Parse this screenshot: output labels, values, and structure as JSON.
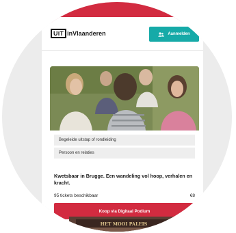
{
  "header": {
    "logo_box": "UiT",
    "logo_text": "inVlaanderen",
    "login_label": "Aanmelden"
  },
  "event": {
    "tags": [
      "Begeleide uitstap of rondleiding",
      "Persoon en relaties"
    ],
    "title": "Kwetsbaar in Brugge. Een wandeling vol hoop, verhalen en kracht.",
    "tickets": "95 tickets beschikbaar",
    "price": "€8",
    "buy_label": "Koop via Digitaal Podium"
  },
  "next_event": {
    "sign_text": "HET MOOI PALEIS"
  },
  "colors": {
    "brand_red": "#d22b40",
    "teal": "#16aaa8"
  },
  "icons": {
    "login": "users-icon"
  }
}
